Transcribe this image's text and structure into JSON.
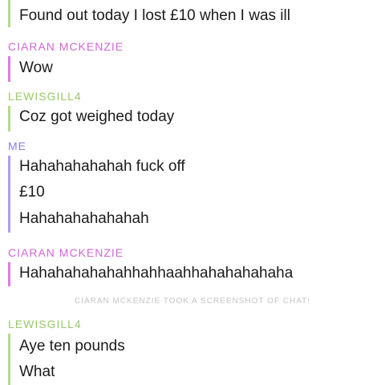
{
  "chat": {
    "block1": {
      "messages": [
        "Found out today I lost £10 when I was ill"
      ]
    },
    "block2": {
      "sender": "CIARAN  MCKENZIE",
      "messages": [
        "Wow"
      ]
    },
    "block3": {
      "sender": "LEWISGILL4",
      "messages": [
        "Coz got weighed today"
      ]
    },
    "block4": {
      "sender": "ME",
      "messages": [
        "Hahahahahahah fuck off",
        "£10",
        "Hahahahahahahah"
      ]
    },
    "block5": {
      "sender": "CIARAN  MCKENZIE",
      "messages": [
        "Hahahahahahahhahhaahhahahahahaha"
      ]
    },
    "notice": "CIARAN  MCKENZIE  TOOK A SCREENSHOT OF CHAT!",
    "block6": {
      "sender": "LEWISGILL4",
      "messages": [
        "Aye ten pounds",
        "What"
      ]
    }
  },
  "colors": {
    "friend_green": "#9ac86a",
    "friend_pink": "#cf67d6",
    "me_blue": "#8a7ee5",
    "notice_gray": "#c5c5c5"
  }
}
